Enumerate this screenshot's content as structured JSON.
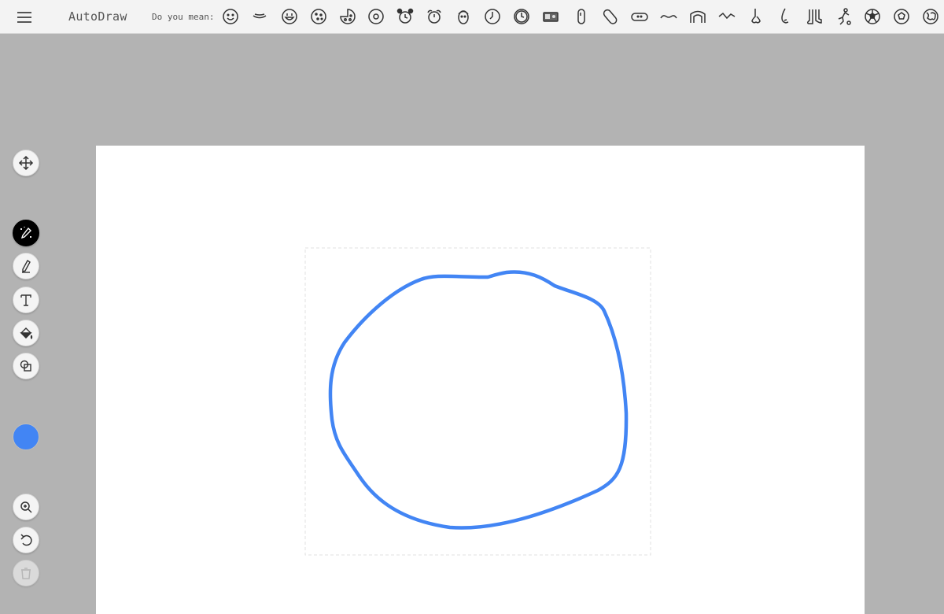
{
  "app": {
    "title": "AutoDraw"
  },
  "toolbar": {
    "suggestion_label": "Do you mean:",
    "suggestions": [
      "smiley-face-icon",
      "mouth-icon",
      "grinning-face-icon",
      "cookie-icon",
      "pizza-icon",
      "donut-icon",
      "alarm-clock-icon",
      "clock-with-bells-icon",
      "face-icon",
      "wall-clock-icon",
      "round-clock-icon",
      "radio-icon",
      "bean-icon",
      "pill-icon",
      "bandage-icon",
      "mustache-icon",
      "arch-icon",
      "wave-line-icon",
      "nose-icon",
      "ear-icon",
      "feet-icon",
      "soccer-player-icon",
      "soccer-ball-icon",
      "ball-icon",
      "globe-icon"
    ]
  },
  "sidebar": {
    "tools": [
      {
        "id": "select",
        "icon": "move-arrows-icon"
      },
      {
        "id": "autodraw",
        "icon": "magic-pen-icon",
        "active": true
      },
      {
        "id": "draw",
        "icon": "pencil-icon"
      },
      {
        "id": "type",
        "icon": "text-icon"
      },
      {
        "id": "fill",
        "icon": "paint-bucket-icon"
      },
      {
        "id": "shape",
        "icon": "shapes-icon"
      }
    ],
    "color": {
      "hex": "#4285f4"
    },
    "bottom_tools": [
      {
        "id": "zoom",
        "icon": "zoom-in-icon"
      },
      {
        "id": "undo",
        "icon": "undo-icon"
      },
      {
        "id": "delete",
        "icon": "trash-icon",
        "disabled": true
      }
    ]
  },
  "colors": {
    "stroke": "#4285f4",
    "canvas": "#ffffff",
    "workspace": "#b3b3b3",
    "topbar": "#f3f3f3"
  }
}
